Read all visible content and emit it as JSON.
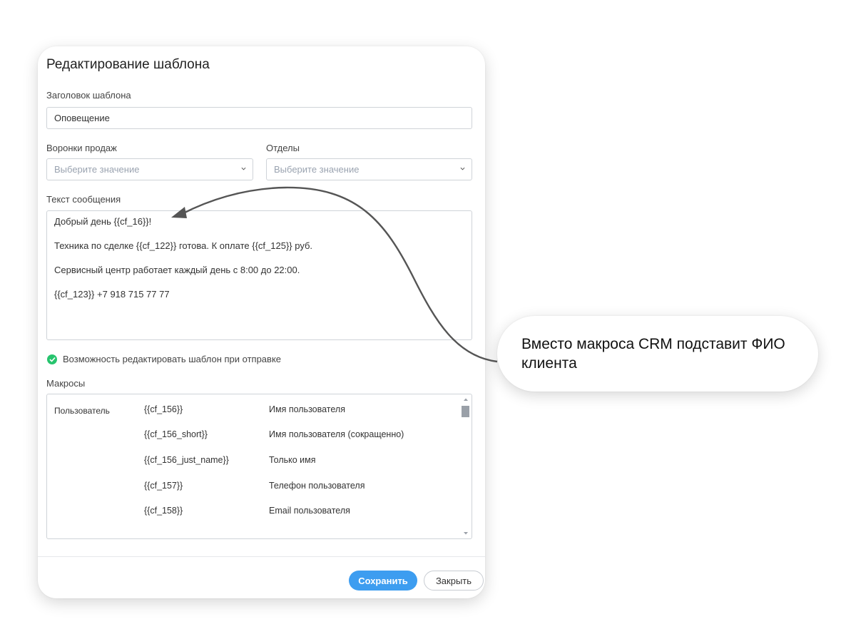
{
  "modal": {
    "title": "Редактирование шаблона",
    "template_title_label": "Заголовок шаблона",
    "template_title_value": "Оповещение",
    "funnels_label": "Воронки продаж",
    "funnels_placeholder": "Выберите значение",
    "departments_label": "Отделы",
    "departments_placeholder": "Выберите значение",
    "message_label": "Текст сообщения",
    "message_lines": [
      "Добрый день {{cf_16}}!",
      "Техника по сделке {{cf_122}} готова. К оплате {{cf_125}} руб.",
      "Сервисный центр работает каждый день с 8:00 до 22:00.",
      "{{cf_123}} +7 918 715 77 77"
    ],
    "editable_option": "Возможность редактировать шаблон при отправке",
    "editable_checked": true,
    "macros_label": "Макросы",
    "macros": {
      "group": "Пользователь",
      "rows": [
        {
          "code": "{{cf_156}}",
          "desc": "Имя пользователя"
        },
        {
          "code": "{{cf_156_short}}",
          "desc": "Имя пользователя (сокращенно)"
        },
        {
          "code": "{{cf_156_just_name}}",
          "desc": "Только имя"
        },
        {
          "code": "{{cf_157}}",
          "desc": "Телефон пользователя"
        },
        {
          "code": "{{cf_158}}",
          "desc": "Email пользователя"
        }
      ]
    },
    "save_label": "Сохранить",
    "close_label": "Закрыть"
  },
  "callout": {
    "text": "Вместо макроса CRM подставит ФИО клиента"
  },
  "colors": {
    "primary_button": "#3d9df0",
    "check_green": "#27c46e",
    "placeholder": "#9aa3b0"
  },
  "icons": [
    "chevron-down-icon",
    "check-circle-icon",
    "scroll-up-arrow-icon",
    "scroll-down-arrow-icon",
    "annotation-arrow-icon"
  ]
}
